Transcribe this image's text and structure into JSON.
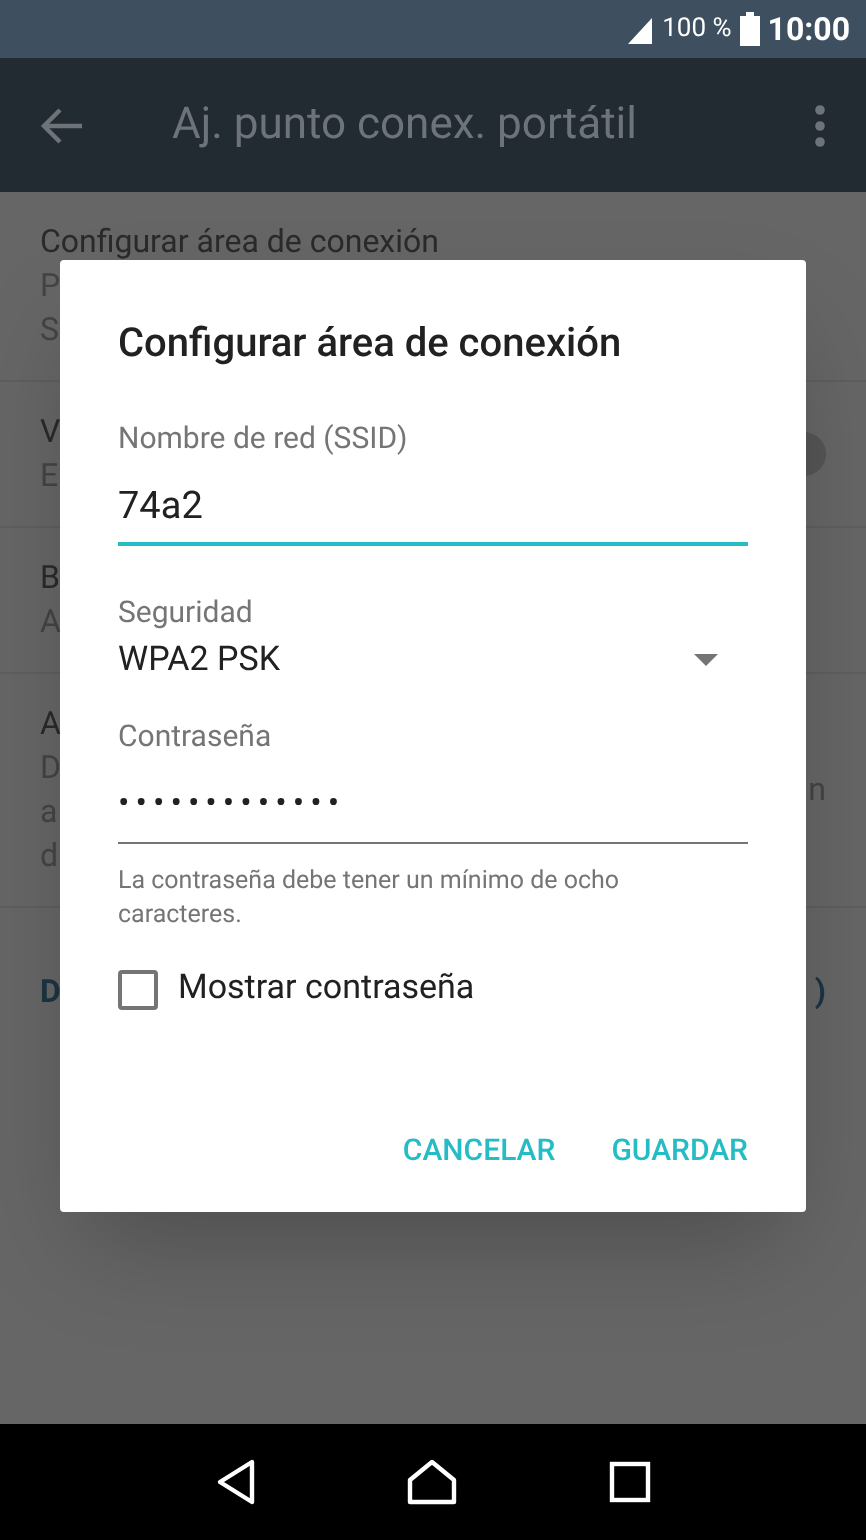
{
  "status_bar": {
    "battery": "100 %",
    "time": "10:00"
  },
  "app_bar": {
    "title": "Aj. punto conex. portátil"
  },
  "background_rows": [
    {
      "lines": [
        "Configurar área de conexión",
        "P",
        "S"
      ],
      "toggle": false,
      "trailing": []
    },
    {
      "lines": [
        "V",
        "E"
      ],
      "toggle": true,
      "trailing": []
    },
    {
      "lines": [
        "B",
        "A"
      ],
      "toggle": false,
      "trailing": []
    },
    {
      "lines": [
        "A",
        "D",
        "a",
        "d"
      ],
      "toggle": false,
      "trailing": [
        "n"
      ]
    }
  ],
  "background_link": {
    "text": "D",
    "trailing": ")"
  },
  "dialog": {
    "title": "Configurar área de conexión",
    "ssid": {
      "label": "Nombre de red (SSID)",
      "value": "74a2"
    },
    "security": {
      "label": "Seguridad",
      "value": "WPA2 PSK"
    },
    "password": {
      "label": "Contraseña",
      "value": "•••••••••••••",
      "hint": "La contraseña debe tener un mínimo de ocho caracteres."
    },
    "show_password": {
      "label": "Mostrar contraseña",
      "checked": false
    },
    "buttons": [
      "CANCELAR",
      "GUARDAR"
    ]
  }
}
